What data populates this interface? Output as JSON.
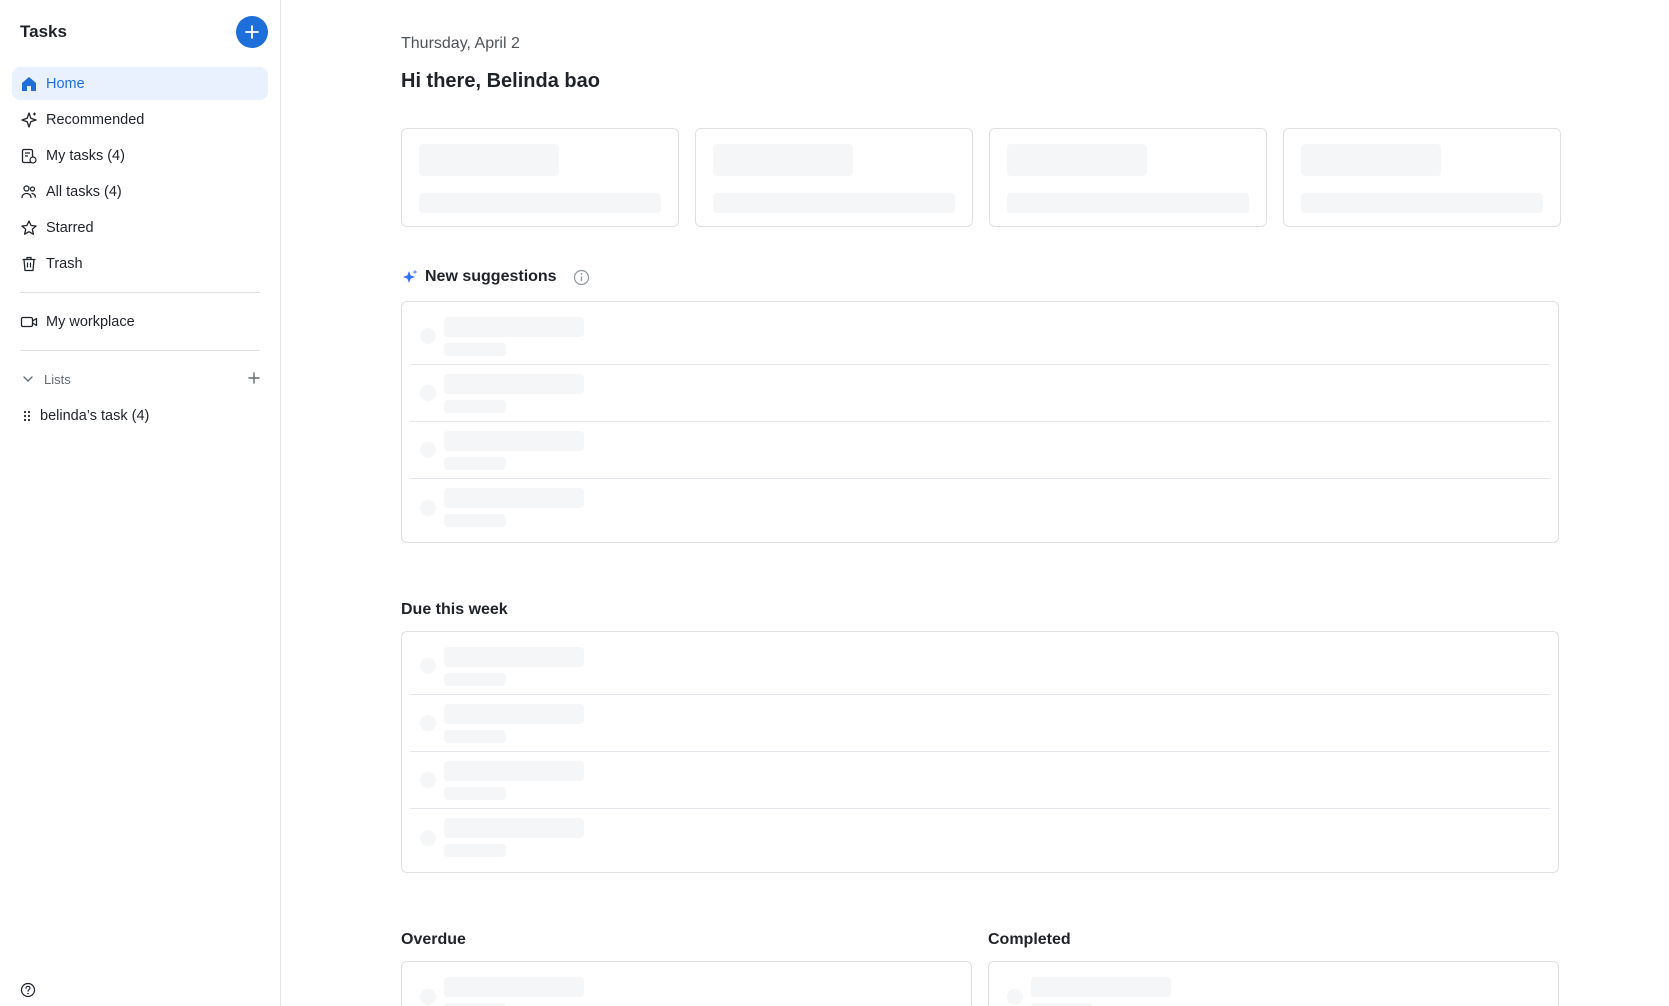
{
  "sidebar": {
    "title": "Tasks",
    "nav": [
      {
        "label": "Home",
        "icon": "home-icon",
        "active": true
      },
      {
        "label": "Recommended",
        "icon": "sparkle-icon"
      },
      {
        "label": "My tasks (4)",
        "icon": "my-tasks-icon"
      },
      {
        "label": "All tasks (4)",
        "icon": "people-icon"
      },
      {
        "label": "Starred",
        "icon": "star-icon"
      },
      {
        "label": "Trash",
        "icon": "trash-icon"
      }
    ],
    "workplace": {
      "label": "My workplace",
      "icon": "video-icon"
    },
    "lists_header": "Lists",
    "lists": [
      {
        "label": "belinda’s task (4)",
        "icon": "drag-handle-icon"
      }
    ]
  },
  "main": {
    "date": "Thursday, April 2",
    "greeting": "Hi there, Belinda bao",
    "suggestions_title": "New suggestions",
    "due_title": "Due this week",
    "overdue_title": "Overdue",
    "completed_title": "Completed"
  },
  "colors": {
    "accent": "#1f6fdb",
    "active_bg": "#eaf1fe",
    "skeleton": "#f5f6f7",
    "border": "#dee0e3"
  }
}
